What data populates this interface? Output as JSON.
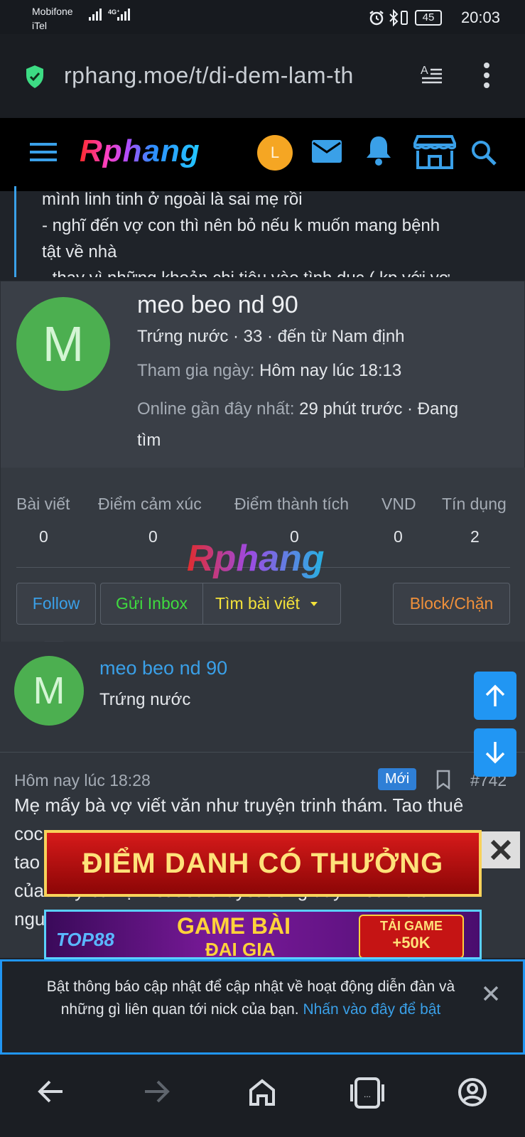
{
  "status_bar": {
    "carrier_1": "Mobifone",
    "carrier_2": "iTel",
    "network_label": "4G⁺",
    "battery": "45",
    "time": "20:03"
  },
  "browser": {
    "url": "rphang.moe/t/di-dem-lam-th"
  },
  "site": {
    "logo_text": "Rphang",
    "user_initial": "L"
  },
  "post_snippet": {
    "lines": [
      "mình linh tinh ở ngoài là sai mẹ rồi",
      "- nghĩ đến vợ con thì nên bỏ nếu k muốn mang bệnh",
      "tật về nhà",
      "- thay vì những khoản chi tiêu vào tình dục ( kp với vợ"
    ]
  },
  "profile_card": {
    "avatar_letter": "M",
    "username": "meo beo nd 90",
    "subtitle": "Trứng nước · 33 · đến từ Nam định",
    "joined_label": "Tham gia ngày:",
    "joined_value": "Hôm nay lúc 18:13",
    "online_label": "Online gần đây nhất:",
    "online_value_1": "29 phút trước · Đang",
    "online_value_2": "tìm",
    "stats": [
      {
        "label": "Bài viết",
        "value": "0"
      },
      {
        "label": "Điểm cảm xúc",
        "value": "0"
      },
      {
        "label": "Điểm thành tích",
        "value": "0"
      },
      {
        "label": "VND",
        "value": "0"
      },
      {
        "label": "Tín dụng",
        "value": "2"
      }
    ],
    "watermark": "Rphang",
    "buttons": {
      "follow": "Follow",
      "inbox": "Gửi Inbox",
      "find_posts": "Tìm bài viết",
      "block": "Block/Chặn"
    }
  },
  "post_author": {
    "avatar_letter": "M",
    "name": "meo beo nd 90",
    "rank": "Trứng nước"
  },
  "post": {
    "date": "Hôm nay lúc 18:28",
    "badge_new": "Mới",
    "number": "#742",
    "body_lines": [
      "Mẹ mấy bà vợ viết văn như truyện trinh thám. Tao thuê",
      "coc",
      "tao",
      "của mấy bà vợ viết tiểu thuyết trong đây. Đoán là tk",
      "ngu"
    ]
  },
  "ads": {
    "banner_1": "ĐIỂM DANH CÓ THƯỞNG",
    "banner_2_brand": "TOP88",
    "banner_2_text": "GAME BÀI",
    "banner_2_sub": "ĐẠI GIA",
    "banner_2_cta_1": "TẢI GAME",
    "banner_2_cta_2": "+50K"
  },
  "notification": {
    "text_1": "Bật thông báo cập nhật để cập nhật về hoạt động diễn đàn và",
    "text_2": "những gì liên quan tới nick của bạn.",
    "link": "Nhấn vào đây để bật"
  },
  "colors": {
    "accent": "#2196f3",
    "follow": "#3aa0e8",
    "inbox": "#3fdc3f",
    "find": "#f4e23a",
    "block": "#f0903a",
    "avatar_green": "#4caf50",
    "user_orange": "#f5a623"
  }
}
